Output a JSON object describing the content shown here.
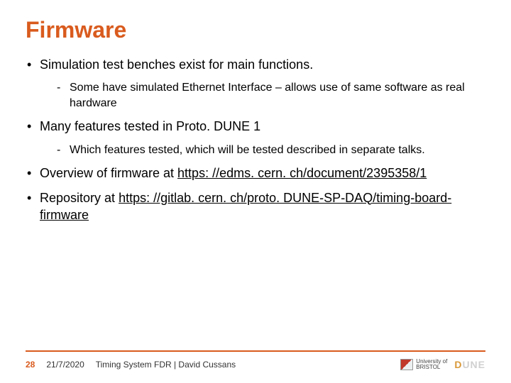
{
  "title": "Firmware",
  "bullets": {
    "b1": "Simulation test benches exist for main functions.",
    "b1_1": "Some have simulated Ethernet Interface – allows use of same software as real hardware",
    "b2": "Many features tested in Proto. DUNE 1",
    "b2_1": "Which features tested, which will be tested described in separate talks.",
    "b3_pre": "Overview of firmware at ",
    "b3_link": "https: //edms. cern. ch/document/2395358/1",
    "b4_pre": "Repository at ",
    "b4_link": "https: //gitlab. cern. ch/proto. DUNE-SP-DAQ/timing-board-firmware"
  },
  "footer": {
    "page": "28",
    "date": "21/7/2020",
    "caption": "Timing System FDR | David Cussans",
    "bristol_line1": "University of",
    "bristol_line2": "BRISTOL",
    "dune_d": "D",
    "dune_rest": "UNE"
  }
}
